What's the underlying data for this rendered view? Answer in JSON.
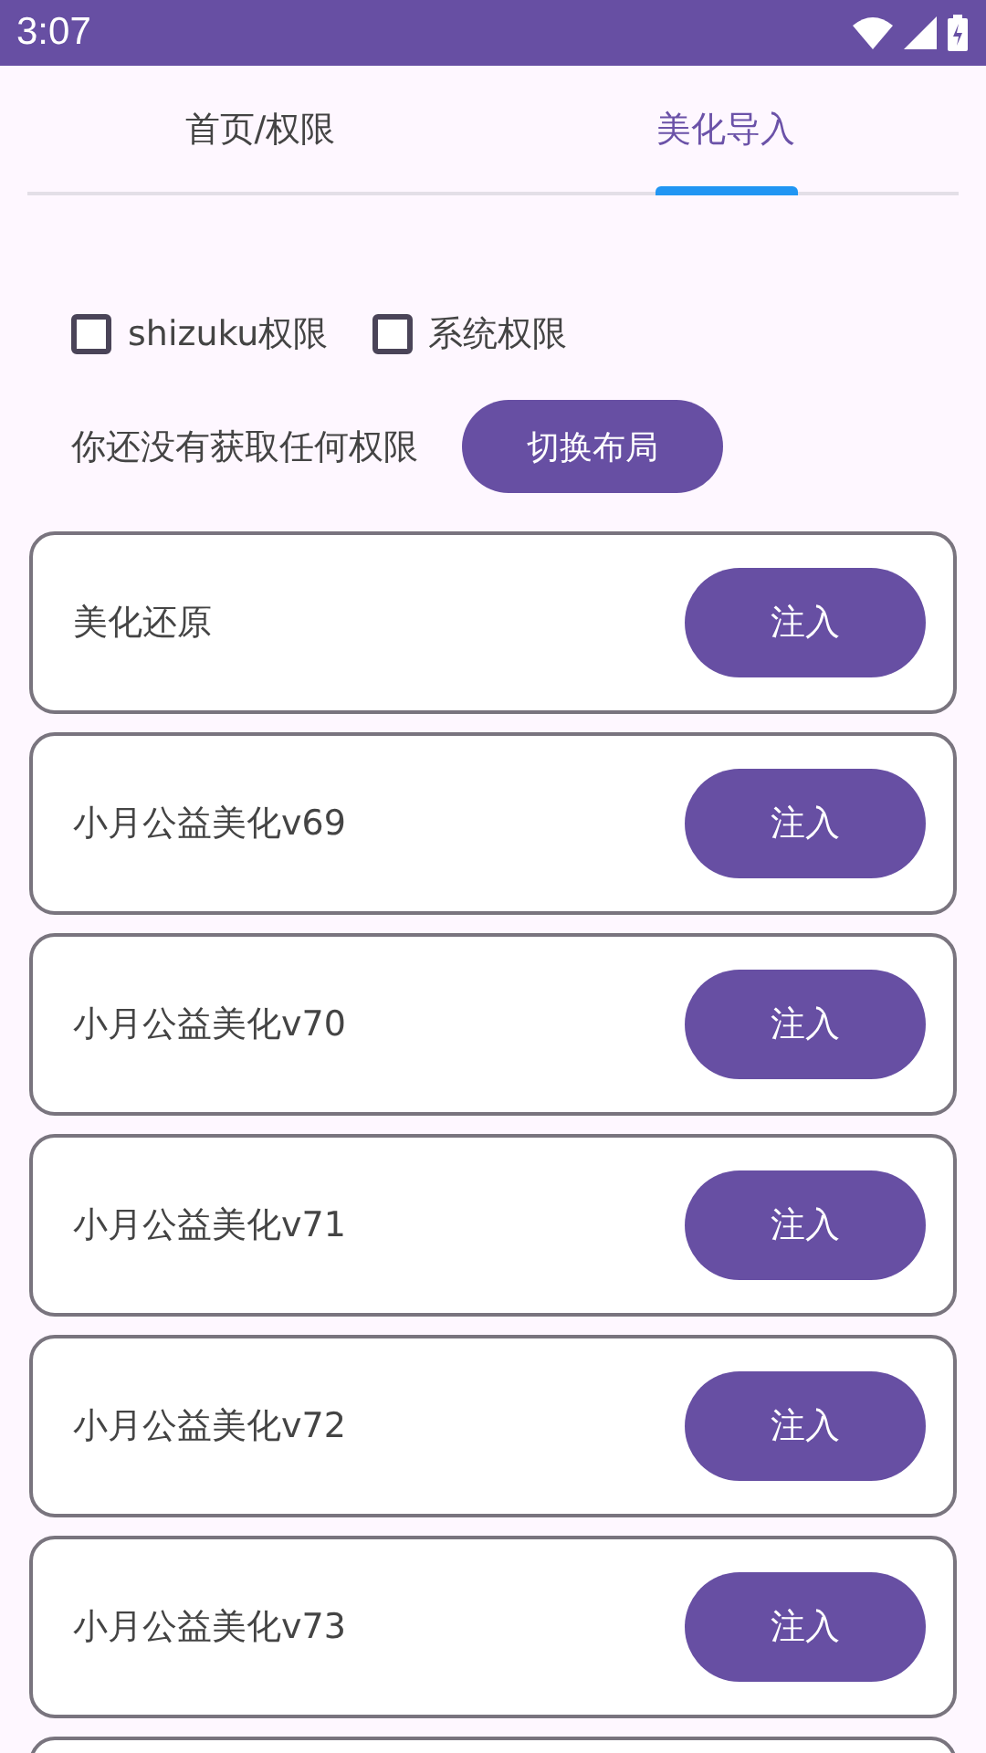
{
  "status_bar": {
    "time": "3:07"
  },
  "tabs": [
    {
      "label": "首页/权限",
      "selected": false
    },
    {
      "label": "美化导入",
      "selected": true
    }
  ],
  "permissions": [
    {
      "label": "shizuku权限",
      "checked": false
    },
    {
      "label": "系统权限",
      "checked": false
    }
  ],
  "status_text": "你还没有获取任何权限",
  "switch_button": "切换布局",
  "items": [
    {
      "kind": "item",
      "label": "美化还原",
      "button": "注入"
    },
    {
      "kind": "item",
      "label": "小月公益美化v69",
      "button": "注入"
    },
    {
      "kind": "item",
      "label": "小月公益美化v70",
      "button": "注入"
    },
    {
      "kind": "item",
      "label": "小月公益美化v71",
      "button": "注入"
    },
    {
      "kind": "item",
      "label": "小月公益美化v72",
      "button": "注入"
    },
    {
      "kind": "item",
      "label": "小月公益美化v73",
      "button": "注入"
    },
    {
      "kind": "cut"
    }
  ]
}
